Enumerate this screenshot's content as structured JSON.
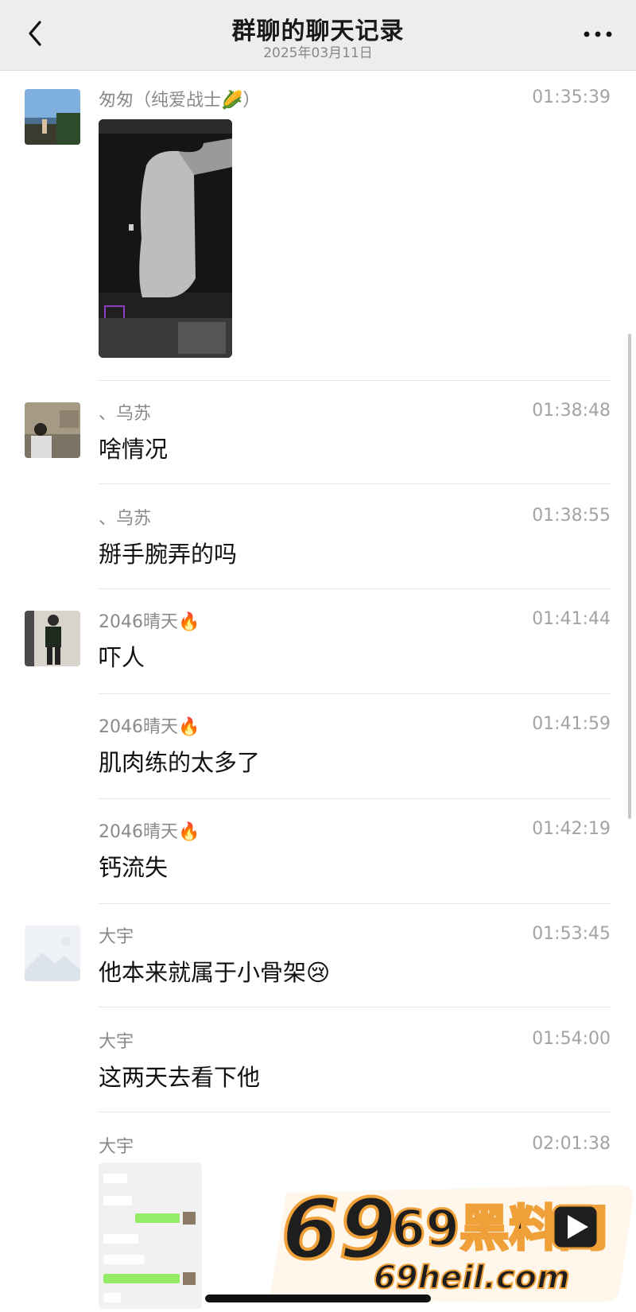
{
  "header": {
    "title": "群聊的聊天记录",
    "date": "2025年03月11日"
  },
  "messages": [
    {
      "name": "匆匆（纯爱战士🌽）",
      "time": "01:35:39",
      "type": "image"
    },
    {
      "name": "、乌苏",
      "time": "01:38:48",
      "text": "啥情况"
    },
    {
      "name": "、乌苏",
      "time": "01:38:55",
      "text": "掰手腕弄的吗"
    },
    {
      "name": "2046晴天🔥",
      "time": "01:41:44",
      "text": "吓人"
    },
    {
      "name": "2046晴天🔥",
      "time": "01:41:59",
      "text": "肌肉练的太多了"
    },
    {
      "name": "2046晴天🔥",
      "time": "01:42:19",
      "text": "钙流失"
    },
    {
      "name": "大宇",
      "time": "01:53:45",
      "text": "他本来就属于小骨架😢"
    },
    {
      "name": "大宇",
      "time": "01:54:00",
      "text": "这两天去看下他"
    },
    {
      "name": "大宇",
      "time": "02:01:38",
      "type": "image"
    }
  ],
  "watermark": {
    "line1": "69黑料网",
    "line2": "69heil.com"
  }
}
